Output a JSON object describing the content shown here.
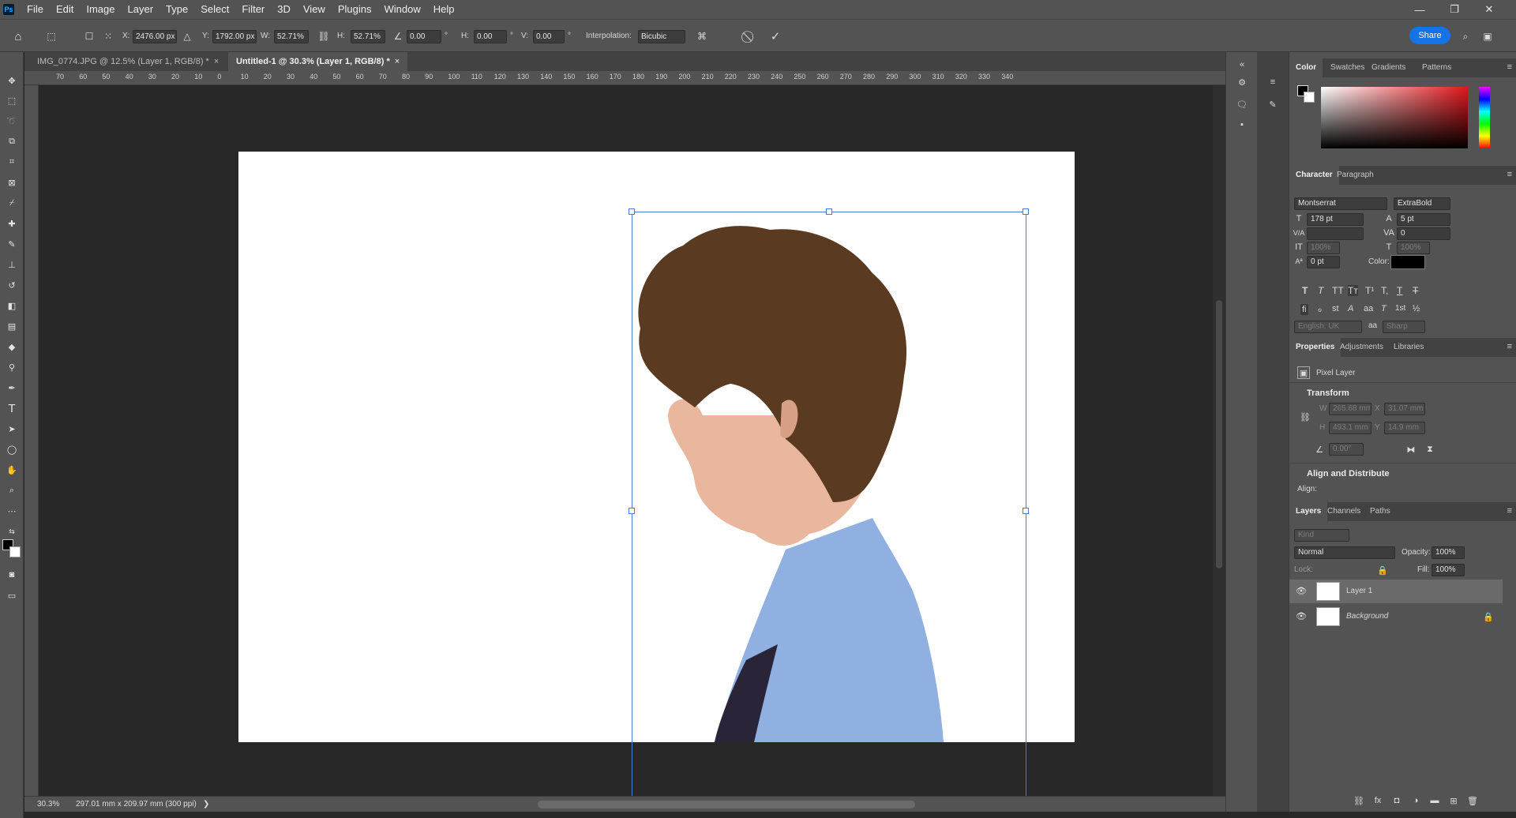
{
  "app": {
    "logo_text": "Ps"
  },
  "menu": [
    "File",
    "Edit",
    "Image",
    "Layer",
    "Type",
    "Select",
    "Filter",
    "3D",
    "View",
    "Plugins",
    "Window",
    "Help"
  ],
  "window_controls": {
    "minimize": "—",
    "restore": "❐",
    "close": "✕"
  },
  "options_bar": {
    "x_label": "X:",
    "x_value": "2476.00 px",
    "y_label": "Y:",
    "y_value": "1792.00 px",
    "w_label": "W:",
    "w_value": "52.71%",
    "h_label": "H:",
    "h_value": "52.71%",
    "angle_value": "0.00",
    "angle_unit": "°",
    "hskew_label": "H:",
    "hskew_value": "0.00",
    "vskew_label": "V:",
    "vskew_value": "0.00",
    "interp_label": "Interpolation:",
    "interp_value": "Bicubic",
    "share_label": "Share"
  },
  "doc_tabs": [
    {
      "label": "IMG_0774.JPG @ 12.5% (Layer 1, RGB/8) *",
      "close": "×"
    },
    {
      "label": "Untitled-1 @ 30.3% (Layer 1, RGB/8) *",
      "close": "×"
    }
  ],
  "ruler_top": [
    "70",
    "60",
    "50",
    "40",
    "30",
    "20",
    "10",
    "0",
    "10",
    "20",
    "30",
    "40",
    "50",
    "60",
    "70",
    "80",
    "90",
    "100",
    "110",
    "120",
    "130",
    "140",
    "150",
    "160",
    "170",
    "180",
    "190",
    "200",
    "210",
    "220",
    "230",
    "240",
    "250",
    "260",
    "270",
    "280",
    "290",
    "300",
    "310",
    "320",
    "330",
    "340"
  ],
  "status": {
    "zoom": "30.3%",
    "doc_info": "297.01 mm x 209.97 mm (300 ppi)",
    "arrow": "❯"
  },
  "color_panel": {
    "tabs": [
      "Color",
      "Swatches",
      "Gradients",
      "Patterns"
    ]
  },
  "character_panel": {
    "tabs": [
      "Character",
      "Paragraph"
    ],
    "font_family": "Montserrat",
    "font_style": "ExtraBold",
    "font_size": "178 pt",
    "leading": "5 pt",
    "kerning": "",
    "tracking": "0",
    "vscale": "100%",
    "hscale": "100%",
    "baseline": "0 pt",
    "color_label": "Color:",
    "style_buttons": [
      "T",
      "T",
      "TT",
      "Tт",
      "T¹",
      "T,",
      "T",
      "T"
    ],
    "ot_buttons": [
      "fi",
      "ℴ",
      "st",
      "A",
      "aa",
      "T",
      "1st",
      "½"
    ],
    "language": "English: UK",
    "aa_icon": "aa",
    "antialias": "Sharp"
  },
  "properties_panel": {
    "tabs": [
      "Properties",
      "Adjustments",
      "Libraries"
    ],
    "layer_type": "Pixel Layer",
    "transform_title": "Transform",
    "w_label": "W",
    "w_value": "265.68 mm",
    "x_label": "X",
    "x_value": "31.07 mm",
    "h_label": "H",
    "h_value": "493.1 mm",
    "y_label": "Y",
    "y_value": "14.9 mm",
    "angle_value": "0.00°",
    "align_title": "Align and Distribute",
    "align_label": "Align:"
  },
  "layers_panel": {
    "tabs": [
      "Layers",
      "Channels",
      "Paths"
    ],
    "filter_placeholder": "Kind",
    "blend_mode": "Normal",
    "opacity_label": "Opacity:",
    "opacity_value": "100%",
    "lock_label": "Lock:",
    "fill_label": "Fill:",
    "fill_value": "100%",
    "layers": [
      {
        "name": "Layer 1",
        "selected": true
      },
      {
        "name": "Background",
        "selected": false
      }
    ]
  },
  "colors": {
    "accent": "#1473e6",
    "selection": "#4b7bd6",
    "chrome": "#535353",
    "pasteboard": "#282828",
    "shirt": "#8fb0e0",
    "hair": "#5a3a20",
    "tie": "#2a2438"
  }
}
